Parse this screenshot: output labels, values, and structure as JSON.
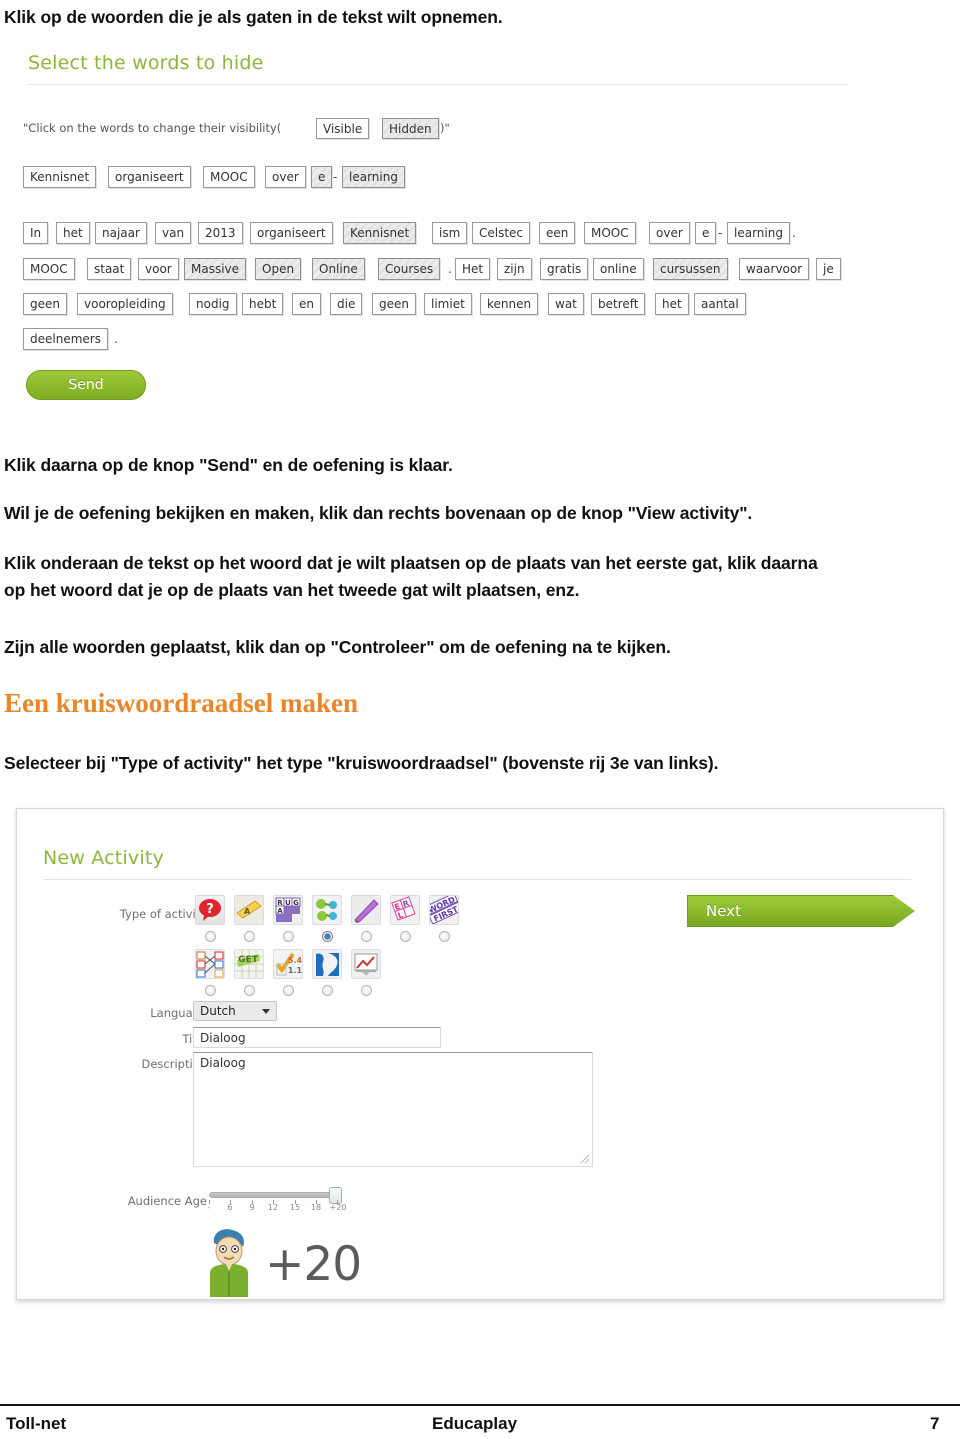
{
  "intro": {
    "line": "Klik op de woorden die je als gaten in de tekst wilt opnemen."
  },
  "screenshot_select_words": {
    "title": "Select the words to hide",
    "hint_prefix": "\"Click on the words to change their visibility(",
    "hint_visible": "Visible",
    "hint_hidden": "Hidden",
    "hint_suffix": ")\"",
    "preview_row": [
      {
        "text": "Kennisnet",
        "hidden": false
      },
      {
        "text": "organiseert",
        "hidden": false
      },
      {
        "text": "MOOC",
        "hidden": false
      },
      {
        "text": "over",
        "hidden": false
      },
      {
        "text": "e",
        "hidden": true
      },
      {
        "text": "learning",
        "hidden": true
      }
    ],
    "preview_separator": "-",
    "text_rows": [
      [
        {
          "text": "In",
          "hidden": false
        },
        {
          "text": "het",
          "hidden": false
        },
        {
          "text": "najaar",
          "hidden": false
        },
        {
          "text": "van",
          "hidden": false
        },
        {
          "text": "2013",
          "hidden": false
        },
        {
          "text": "organiseert",
          "hidden": false
        },
        {
          "text": "Kennisnet",
          "hidden": true
        },
        {
          "text": "ism",
          "hidden": false
        },
        {
          "text": "Celstec",
          "hidden": false
        },
        {
          "text": "een",
          "hidden": false
        },
        {
          "text": "MOOC",
          "hidden": false
        },
        {
          "text": "over",
          "hidden": false
        },
        {
          "text": "e",
          "hidden": false
        },
        {
          "text": "learning",
          "hidden": false
        }
      ],
      [
        {
          "text": "MOOC",
          "hidden": false
        },
        {
          "text": "staat",
          "hidden": false
        },
        {
          "text": "voor",
          "hidden": false
        },
        {
          "text": "Massive",
          "hidden": true
        },
        {
          "text": "Open",
          "hidden": true
        },
        {
          "text": "Online",
          "hidden": true
        },
        {
          "text": "Courses",
          "hidden": true
        },
        {
          "text": "Het",
          "hidden": false
        },
        {
          "text": "zijn",
          "hidden": false
        },
        {
          "text": "gratis",
          "hidden": false
        },
        {
          "text": "online",
          "hidden": false
        },
        {
          "text": "cursussen",
          "hidden": true
        },
        {
          "text": "waarvoor",
          "hidden": false
        },
        {
          "text": "je",
          "hidden": false
        }
      ],
      [
        {
          "text": "geen",
          "hidden": false
        },
        {
          "text": "vooropleiding",
          "hidden": false
        },
        {
          "text": "nodig",
          "hidden": false
        },
        {
          "text": "hebt",
          "hidden": false
        },
        {
          "text": "en",
          "hidden": false
        },
        {
          "text": "die",
          "hidden": false
        },
        {
          "text": "geen",
          "hidden": false
        },
        {
          "text": "limiet",
          "hidden": false
        },
        {
          "text": "kennen",
          "hidden": false
        },
        {
          "text": "wat",
          "hidden": false
        },
        {
          "text": "betreft",
          "hidden": false
        },
        {
          "text": "het",
          "hidden": false
        },
        {
          "text": "aantal",
          "hidden": false
        }
      ],
      [
        {
          "text": "deelnemers",
          "hidden": false
        }
      ]
    ],
    "send_button": "Send"
  },
  "paragraphs": {
    "p1": "Klik daarna op de knop \"Send\" en de oefening is klaar.",
    "p2": "Wil je de oefening bekijken en maken, klik dan rechts bovenaan op de knop \"View activity\".",
    "p3_line1": "Klik onderaan de tekst op het woord dat je wilt plaatsen op de plaats van het eerste gat, klik daarna",
    "p3_line2": "op het woord dat je op de plaats van het tweede gat wilt plaatsen, enz.",
    "p4": "Zijn alle woorden geplaatst, klik dan op \"Controleer\" om de oefening na te kijken."
  },
  "section_heading": "Een kruiswoordraadsel maken",
  "paragraph_after_heading": "Selecteer bij \"Type of activity\" het type \"kruiswoordraadsel\" (bovenste rij 3e van links).",
  "screenshot_new_activity": {
    "title": "New Activity",
    "labels": {
      "type_of_activity": "Type of activity",
      "language": "Language",
      "title": "Title",
      "description": "Description",
      "audience_age": "Audience Age"
    },
    "activity_icons_row1": [
      {
        "name": "quiz-icon",
        "glyph": "?"
      },
      {
        "name": "dialogue-icon",
        "glyph": "A"
      },
      {
        "name": "crossword-icon",
        "glyph": "RU"
      },
      {
        "name": "matching-icon",
        "glyph": "✦"
      },
      {
        "name": "dictation-icon",
        "glyph": "✒"
      },
      {
        "name": "wordsearch-icon",
        "glyph": "E"
      },
      {
        "name": "wordorder-icon",
        "glyph": "W"
      }
    ],
    "activity_icons_row2": [
      {
        "name": "map-relate-icon",
        "glyph": "C"
      },
      {
        "name": "alphabet-soup-icon",
        "glyph": "G"
      },
      {
        "name": "fill-blanks-icon",
        "glyph": "✓"
      },
      {
        "name": "world-map-icon",
        "glyph": "●"
      },
      {
        "name": "slideshow-icon",
        "glyph": "▤"
      }
    ],
    "selected_activity_index": 3,
    "language_value": "Dutch",
    "title_value": "Dialoog",
    "description_value": "Dialoog",
    "age_ticks": [
      "-",
      "6",
      "9",
      "12",
      "15",
      "18",
      "+20"
    ],
    "age_value": "+20",
    "next_button": "Next"
  },
  "footer": {
    "left": "Toll-net",
    "center": "Educaplay",
    "page": "7"
  },
  "colors": {
    "accent_green": "#8DB63C",
    "heading_orange": "#E8862A",
    "button_green": "#88b82c"
  }
}
